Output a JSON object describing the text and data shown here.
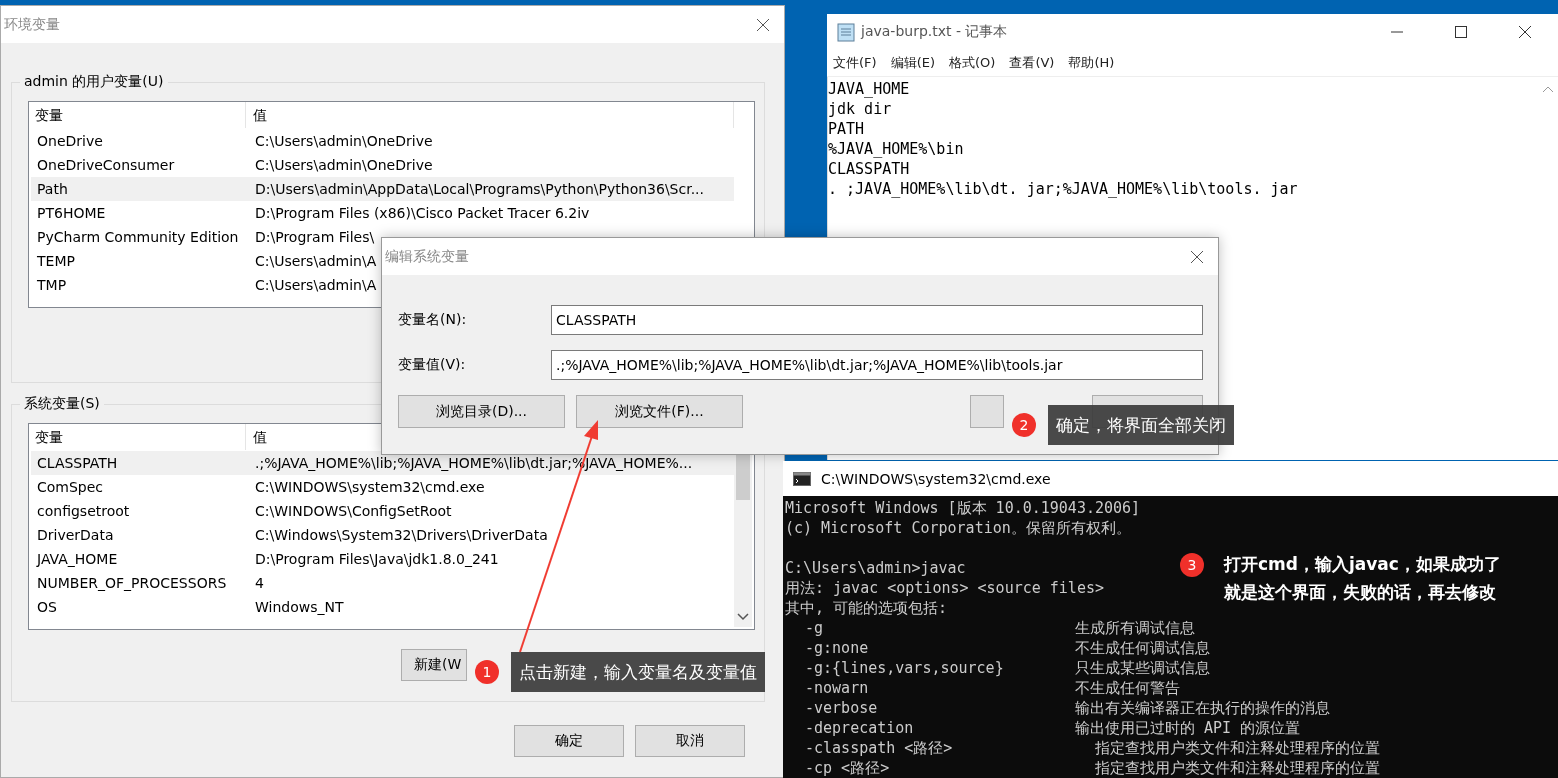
{
  "env_window": {
    "title": "环境变量",
    "user_group": {
      "label": "admin 的用户变量(U)",
      "columns": [
        "变量",
        "值"
      ],
      "rows": [
        {
          "name": "OneDrive",
          "value": "C:\\Users\\admin\\OneDrive",
          "selected": false
        },
        {
          "name": "OneDriveConsumer",
          "value": "C:\\Users\\admin\\OneDrive",
          "selected": false
        },
        {
          "name": "Path",
          "value": "D:\\Users\\admin\\AppData\\Local\\Programs\\Python\\Python36\\Scr...",
          "selected": true
        },
        {
          "name": "PT6HOME",
          "value": "D:\\Program Files (x86)\\Cisco Packet Tracer 6.2iv",
          "selected": false
        },
        {
          "name": "PyCharm Community Edition",
          "value": "D:\\Program Files\\",
          "selected": false
        },
        {
          "name": "TEMP",
          "value": "C:\\Users\\admin\\A",
          "selected": false
        },
        {
          "name": "TMP",
          "value": "C:\\Users\\admin\\A",
          "selected": false
        }
      ]
    },
    "system_group": {
      "label": "系统变量(S)",
      "columns": [
        "变量",
        "值"
      ],
      "rows": [
        {
          "name": "CLASSPATH",
          "value": ".;%JAVA_HOME%\\lib;%JAVA_HOME%\\lib\\dt.jar;%JAVA_HOME%...",
          "selected": true
        },
        {
          "name": "ComSpec",
          "value": "C:\\WINDOWS\\system32\\cmd.exe",
          "selected": false
        },
        {
          "name": "configsetroot",
          "value": "C:\\WINDOWS\\ConfigSetRoot",
          "selected": false
        },
        {
          "name": "DriverData",
          "value": "C:\\Windows\\System32\\Drivers\\DriverData",
          "selected": false
        },
        {
          "name": "JAVA_HOME",
          "value": "D:\\Program Files\\Java\\jdk1.8.0_241",
          "selected": false
        },
        {
          "name": "NUMBER_OF_PROCESSORS",
          "value": "4",
          "selected": false
        },
        {
          "name": "OS",
          "value": "Windows_NT",
          "selected": false
        }
      ],
      "buttons": [
        "新建(W"
      ]
    },
    "buttons": [
      "确定",
      "取消"
    ]
  },
  "edit_dialog": {
    "title": "编辑系统变量",
    "fields": [
      {
        "label": "变量名(N):",
        "value": "CLASSPATH"
      },
      {
        "label": "变量值(V):",
        "value": ".;%JAVA_HOME%\\lib;%JAVA_HOME%\\lib\\dt.jar;%JAVA_HOME%\\lib\\tools.jar"
      }
    ],
    "buttons": [
      "浏览目录(D)...",
      "浏览文件(F)..."
    ]
  },
  "notepad": {
    "title": "java-burp.txt - 记事本",
    "menu": [
      "文件(F)",
      "编辑(E)",
      "格式(O)",
      "查看(V)",
      "帮助(H)"
    ],
    "lines": [
      "JAVA_HOME",
      "jdk dir",
      "PATH",
      "%JAVA_HOME%\\bin",
      "CLASSPATH",
      ". ;JAVA_HOME%\\lib\\dt. jar;%JAVA_HOME%\\lib\\tools. jar"
    ]
  },
  "cmd": {
    "title": "C:\\WINDOWS\\system32\\cmd.exe",
    "intro": [
      "Microsoft Windows [版本 10.0.19043.2006]",
      "(c) Microsoft Corporation。保留所有权利。"
    ],
    "session": [
      "C:\\Users\\admin>javac",
      "用法: javac <options> <source files>",
      "其中, 可能的选项包括:"
    ],
    "options": [
      {
        "flag": "-g",
        "desc": "生成所有调试信息"
      },
      {
        "flag": "-g:none",
        "desc": "不生成任何调试信息"
      },
      {
        "flag": "-g:{lines,vars,source}",
        "desc": "只生成某些调试信息"
      },
      {
        "flag": "-nowarn",
        "desc": "不生成任何警告"
      },
      {
        "flag": "-verbose",
        "desc": "输出有关编译器正在执行的操作的消息"
      },
      {
        "flag": "-deprecation",
        "desc": "输出使用已过时的 API 的源位置"
      },
      {
        "flag": "-classpath <路径>",
        "desc": "指定查找用户类文件和注释处理程序的位置"
      },
      {
        "flag": "-cp <路径>",
        "desc": "指定查找用户类文件和注释处理程序的位置"
      }
    ]
  },
  "callouts": [
    {
      "number": "1",
      "lines": [
        "点击新建，输入变量名及变量值"
      ]
    },
    {
      "number": "2",
      "lines": [
        "确定，将界面全部关闭"
      ]
    },
    {
      "number": "3",
      "lines": [
        "打开cmd，输入javac，如果成功了",
        "就是这个界面，失败的话，再去修改"
      ]
    }
  ]
}
